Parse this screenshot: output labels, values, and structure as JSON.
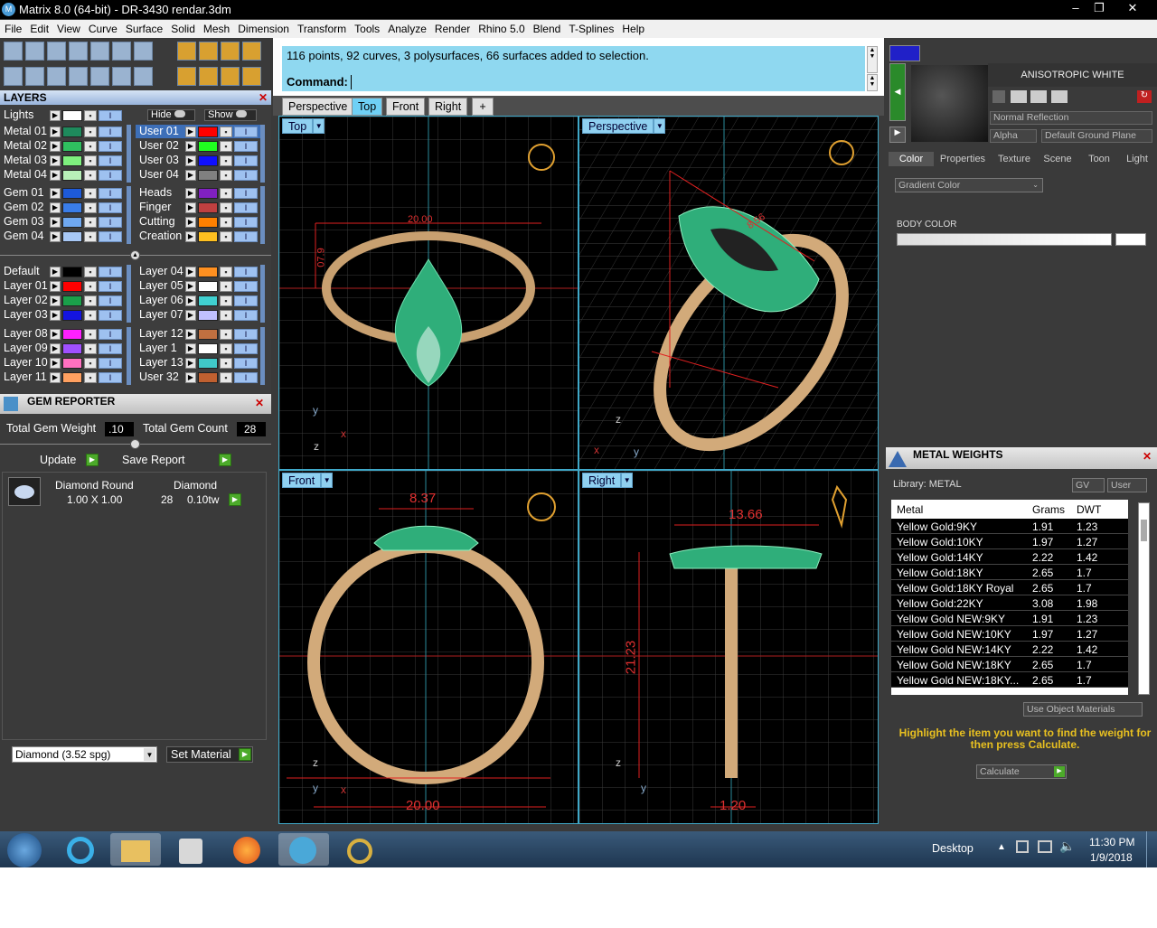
{
  "window": {
    "title": "Matrix 8.0 (64-bit) - DR-3430 rendar.3dm",
    "minimize": "–",
    "restore": "❐",
    "close": "✕"
  },
  "menu": [
    "File",
    "Edit",
    "View",
    "Curve",
    "Surface",
    "Solid",
    "Mesh",
    "Dimension",
    "Transform",
    "Tools",
    "Analyze",
    "Render",
    "Rhino 5.0",
    "Blend",
    "T-Splines",
    "Help"
  ],
  "layers": {
    "title": "LAYERS",
    "lights_label": "Lights",
    "hide_label": "Hide",
    "show_label": "Show",
    "left": [
      {
        "name": "Metal 01",
        "color": "#1e8a5c"
      },
      {
        "name": "Metal 02",
        "color": "#2fbf5f"
      },
      {
        "name": "Metal 03",
        "color": "#7ef07e"
      },
      {
        "name": "Metal 04",
        "color": "#b8f0b8"
      },
      {
        "name": "Gem 01",
        "color": "#1e5ad8"
      },
      {
        "name": "Gem 02",
        "color": "#3a7de8"
      },
      {
        "name": "Gem 03",
        "color": "#6fa8f0"
      },
      {
        "name": "Gem 04",
        "color": "#a8c8f5"
      },
      {
        "name": "Default",
        "color": "#000000"
      },
      {
        "name": "Layer 01",
        "color": "#ff0000"
      },
      {
        "name": "Layer 02",
        "color": "#1aa04a"
      },
      {
        "name": "Layer 03",
        "color": "#1414e0"
      },
      {
        "name": "Layer 08",
        "color": "#ff20ff"
      },
      {
        "name": "Layer 09",
        "color": "#a050ff"
      },
      {
        "name": "Layer 10",
        "color": "#ff70c0"
      },
      {
        "name": "Layer 11",
        "color": "#ffa060"
      }
    ],
    "right": [
      {
        "name": "User 01",
        "color": "#ff0000"
      },
      {
        "name": "User 02",
        "color": "#20ff20"
      },
      {
        "name": "User 03",
        "color": "#1010ff"
      },
      {
        "name": "User 04",
        "color": "#808080"
      },
      {
        "name": "Heads",
        "color": "#8020c0"
      },
      {
        "name": "Finger",
        "color": "#c04040"
      },
      {
        "name": "Cutting",
        "color": "#ff8000"
      },
      {
        "name": "Creation",
        "color": "#ffc020"
      },
      {
        "name": "Layer 04",
        "color": "#ff9020"
      },
      {
        "name": "Layer 05",
        "color": "#ffffff"
      },
      {
        "name": "Layer 06",
        "color": "#40d0d0"
      },
      {
        "name": "Layer 07",
        "color": "#c0c0ff"
      },
      {
        "name": "Layer 12",
        "color": "#c07040"
      },
      {
        "name": "Layer 1",
        "color": "#ffffff"
      },
      {
        "name": "Layer 13",
        "color": "#40c8c8"
      },
      {
        "name": "User 32",
        "color": "#c06030"
      }
    ]
  },
  "gem_reporter": {
    "title": "GEM REPORTER",
    "total_weight_label": "Total Gem Weight",
    "total_weight": ".10",
    "total_count_label": "Total Gem Count",
    "total_count": "28",
    "update_label": "Update",
    "save_label": "Save Report",
    "col1": "Diamond Round",
    "col2": "Diamond",
    "size": "1.00 X 1.00",
    "count": "28",
    "tw": "0.10tw",
    "material": "Diamond    (3.52 spg)",
    "set_material": "Set Material"
  },
  "command": {
    "history": "116 points, 92 curves, 3 polysurfaces, 66 surfaces added to selection.",
    "label": "Command:"
  },
  "view_tabs": [
    "Perspective",
    "Top",
    "Front",
    "Right",
    "+"
  ],
  "viewports": {
    "top": {
      "label": "Top",
      "dim_h": "20.00",
      "dim_v": "07.9",
      "ax1": "y",
      "ax2": "x",
      "ax3": "z"
    },
    "persp": {
      "label": "Perspective",
      "dim": "8.56",
      "ax1": "z",
      "ax2": "y",
      "ax3": "x"
    },
    "front": {
      "label": "Front",
      "dim_top": "8.37",
      "dim_bottom": "20.00",
      "ax1": "z",
      "ax2": "y",
      "ax3": "x"
    },
    "right": {
      "label": "Right",
      "dim_top": "13.66",
      "dim_v": "21.23",
      "dim_bottom": "1.20",
      "ax1": "z",
      "ax2": "y"
    }
  },
  "render": {
    "material_name": "ANISOTROPIC WHITE",
    "reflection": "Normal Reflection",
    "alpha": "Alpha",
    "ground": "Default Ground Plane",
    "tabs": [
      "Color",
      "Properties",
      "Texture",
      "Scene",
      "Toon",
      "Light"
    ],
    "color_mode": "Gradient Color",
    "body_color": "BODY COLOR"
  },
  "metal_weights": {
    "title": "METAL WEIGHTS",
    "library": "Library: METAL",
    "gv": "GV",
    "user": "User",
    "headers": [
      "Metal",
      "Grams",
      "DWT"
    ],
    "rows": [
      [
        "Yellow Gold:9KY",
        "1.91",
        "1.23"
      ],
      [
        "Yellow Gold:10KY",
        "1.97",
        "1.27"
      ],
      [
        "Yellow Gold:14KY",
        "2.22",
        "1.42"
      ],
      [
        "Yellow Gold:18KY",
        "2.65",
        "1.7"
      ],
      [
        "Yellow Gold:18KY Royal",
        "2.65",
        "1.7"
      ],
      [
        "Yellow Gold:22KY",
        "3.08",
        "1.98"
      ],
      [
        "Yellow Gold NEW:9KY",
        "1.91",
        "1.23"
      ],
      [
        "Yellow Gold NEW:10KY",
        "1.97",
        "1.27"
      ],
      [
        "Yellow Gold NEW:14KY",
        "2.22",
        "1.42"
      ],
      [
        "Yellow Gold NEW:18KY",
        "2.65",
        "1.7"
      ],
      [
        "Yellow Gold NEW:18KY...",
        "2.65",
        "1.7"
      ]
    ],
    "use_obj": "Use Object Materials",
    "hint": "Highlight the item you want to find the weight for then press Calculate.",
    "calculate": "Calculate"
  },
  "taskbar": {
    "desktop": "Desktop",
    "time": "11:30 PM",
    "date": "1/9/2018"
  }
}
